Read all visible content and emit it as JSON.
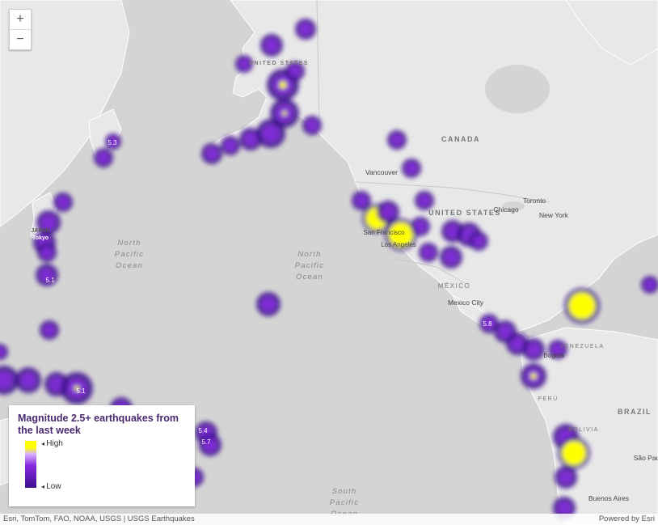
{
  "zoom": {
    "in_label": "+",
    "out_label": "−"
  },
  "legend": {
    "title": "Magnitude 2.5+ earthquakes from the last week",
    "high_label": "High",
    "low_label": "Low"
  },
  "attribution": {
    "sources": "Esri, TomTom, FAO, NOAA, USGS | USGS Earthquakes",
    "powered_by": "Powered by Esri"
  },
  "map_labels": {
    "canada": "CANADA",
    "united_states": "UNITED STATES",
    "united_states_alaska": "UNITED STATES",
    "mexico": "MÉXICO",
    "venezuela": "VENEZUELA",
    "peru": "PERÚ",
    "brazil": "BRAZIL",
    "bolivia": "BOLIVIA",
    "japan": "JAPAN",
    "vancouver": "Vancouver",
    "toronto": "Toronto",
    "chicago": "Chicago",
    "new_york": "New York",
    "san_francisco": "San Francisco",
    "los_angeles": "Los Angeles",
    "mexico_city": "Mexico City",
    "bogota": "Bogotá",
    "buenos_aires": "Buenos Aires",
    "sao_paulo": "São Pau",
    "tokyo": "Tokyo",
    "north_pacific_ocean_west": "North Pacific Ocean",
    "north_pacific_ocean_center": "North Pacific Ocean",
    "south_pacific_ocean": "South Pacific Ocean"
  },
  "magnitude_labels": [
    "5.3",
    "5.1",
    "5.1",
    "5.8",
    "5.4",
    "5.7"
  ],
  "colors": {
    "land": "#e6e6e6",
    "water": "#d4d4d4",
    "heat_low": "#3a0f8c",
    "heat_mid": "#8a2be2",
    "heat_high": "#ffff00"
  }
}
